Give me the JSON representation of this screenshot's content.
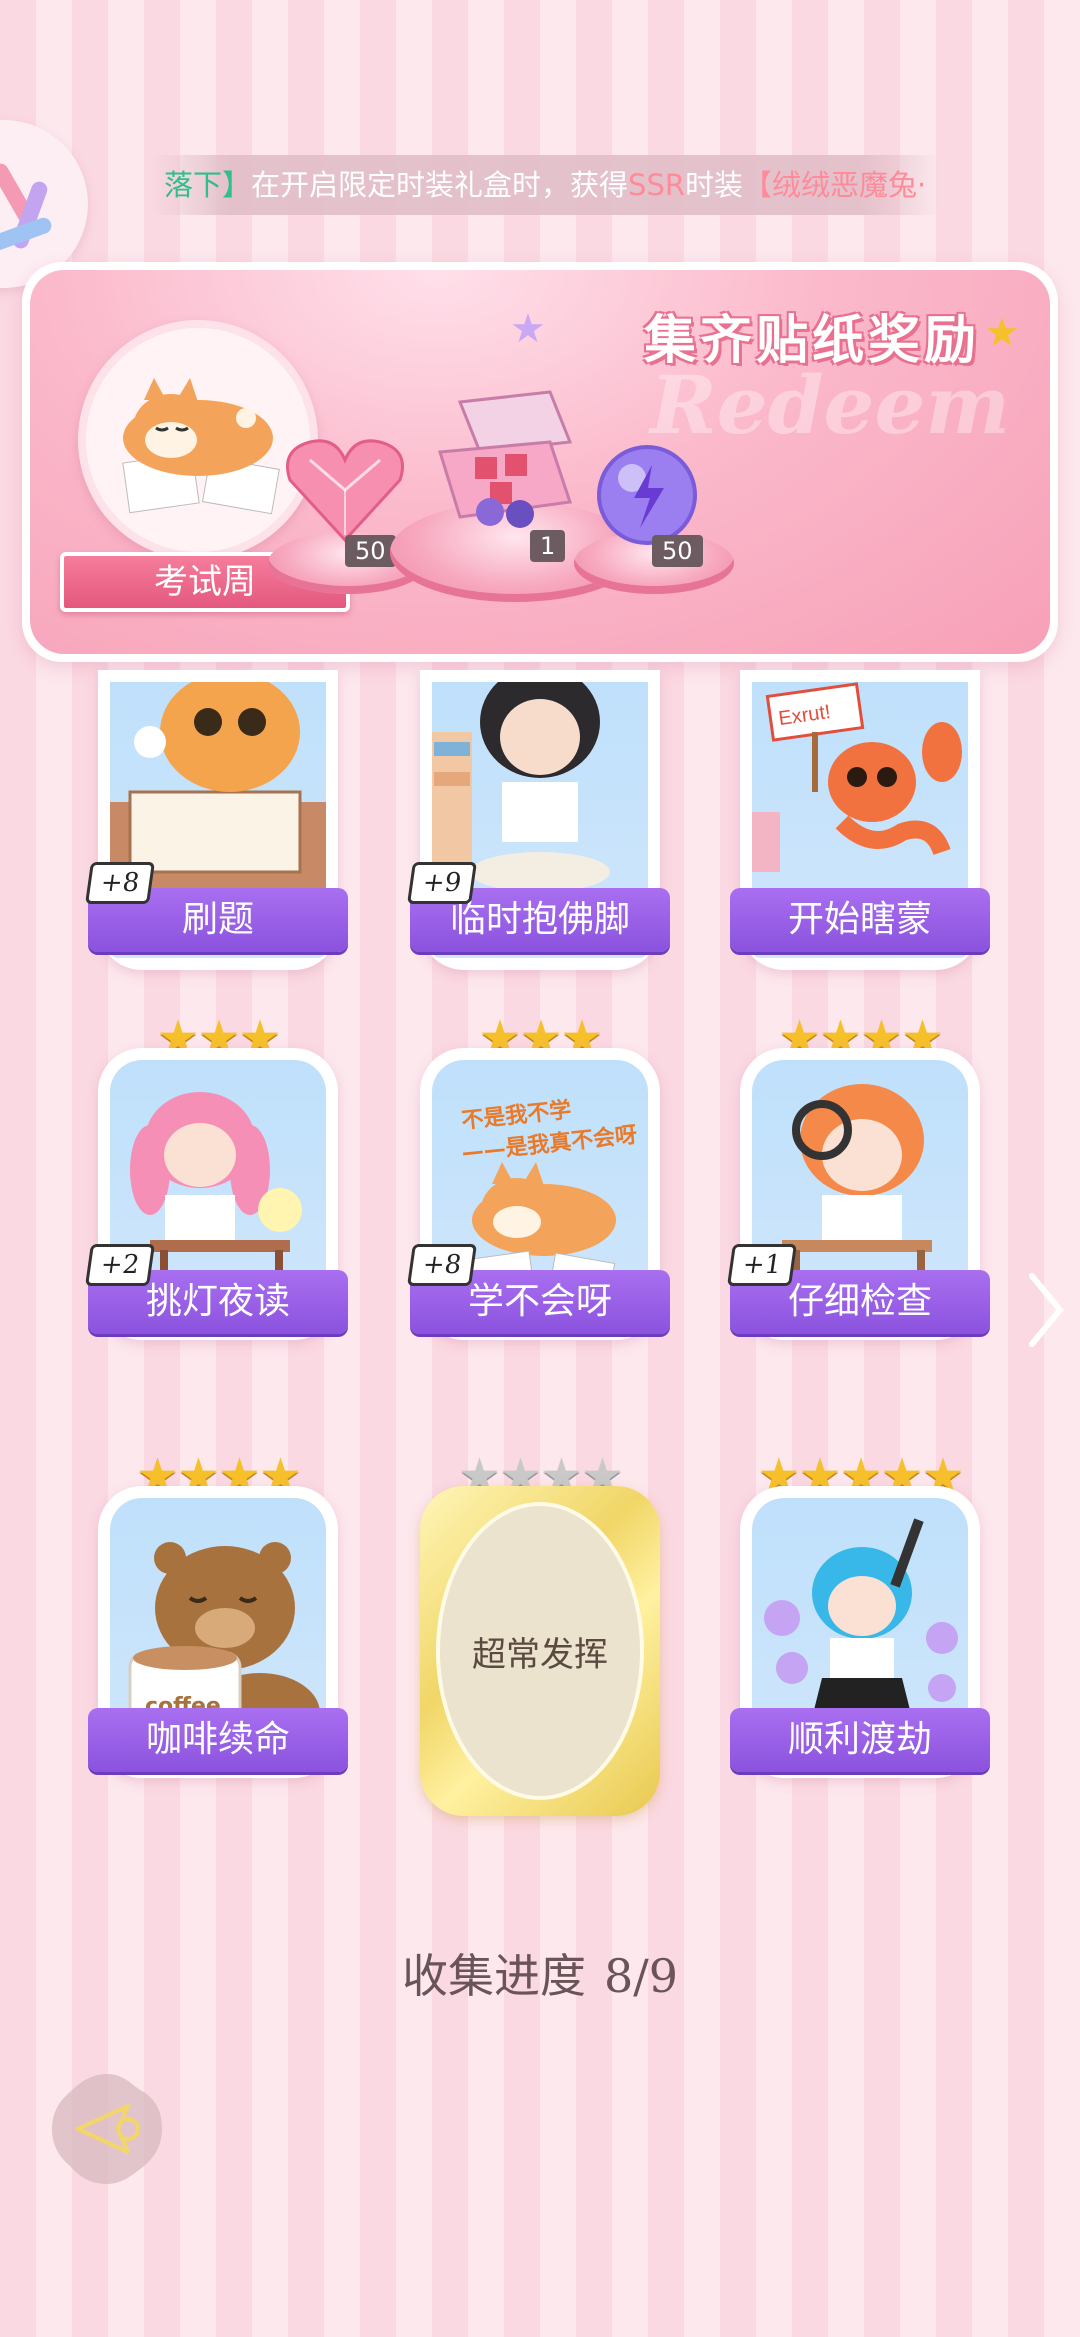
{
  "ticker": {
    "part1": "落下】",
    "part2": "在开启限定时装礼盒时，获得",
    "part3": "SSR",
    "part4": "时装",
    "part5": "【绒绒恶魔兔·"
  },
  "reward_panel": {
    "title": "集齐贴纸奖励",
    "watermark": "Redeem",
    "sticker_name": "考试周",
    "rewards": [
      {
        "name": "heart-gem-icon",
        "count": "50"
      },
      {
        "name": "gift-box-icon",
        "count": "1"
      },
      {
        "name": "purple-orb-icon",
        "count": "50"
      }
    ]
  },
  "cards": [
    {
      "label": "刷题",
      "bonus": "+8",
      "stars_on": 0,
      "stars_total": 0
    },
    {
      "label": "临时抱佛脚",
      "bonus": "+9",
      "stars_on": 0,
      "stars_total": 0
    },
    {
      "label": "开始瞎蒙",
      "bonus": "",
      "stars_on": 0,
      "stars_total": 0,
      "sign_text": "Exrut!"
    },
    {
      "label": "挑灯夜读",
      "bonus": "+2",
      "stars_on": 3,
      "stars_total": 3
    },
    {
      "label": "学不会呀",
      "bonus": "+8",
      "stars_on": 3,
      "stars_total": 3,
      "art_text1": "不是我不学",
      "art_text2": "——是我真不会呀"
    },
    {
      "label": "仔细检查",
      "bonus": "+1",
      "stars_on": 4,
      "stars_total": 4
    },
    {
      "label": "咖啡续命",
      "bonus": "",
      "stars_on": 4,
      "stars_total": 4,
      "cup_text": "coffee"
    },
    {
      "label": "超常发挥",
      "bonus": "",
      "stars_on": 0,
      "stars_total": 4,
      "locked": true
    },
    {
      "label": "顺利渡劫",
      "bonus": "",
      "stars_on": 5,
      "stars_total": 5
    }
  ],
  "progress": {
    "label": "收集进度",
    "value": "8/9"
  },
  "colors": {
    "accent_purple": "#8b52de",
    "pink": "#f57d9c",
    "gold": "#f6c02b"
  }
}
